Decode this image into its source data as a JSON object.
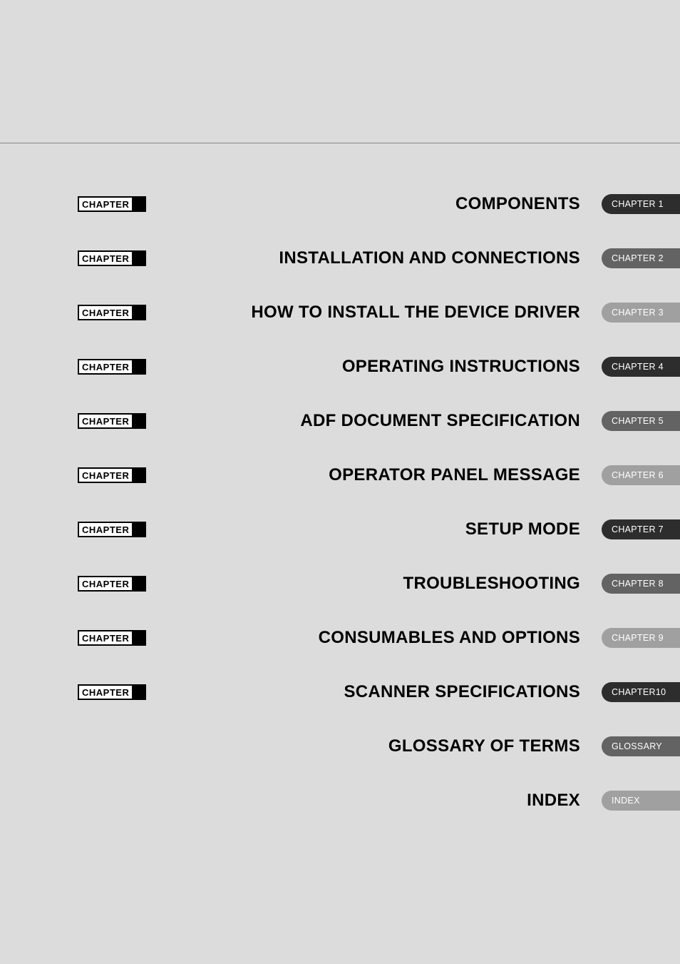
{
  "badge_label": "CHAPTER",
  "rows": [
    {
      "has_badge": true,
      "title": "COMPONENTS",
      "tab": "CHAPTER 1",
      "shade": "dark"
    },
    {
      "has_badge": true,
      "title": "INSTALLATION AND CONNECTIONS",
      "tab": "CHAPTER 2",
      "shade": "mid"
    },
    {
      "has_badge": true,
      "title": "HOW TO INSTALL THE DEVICE DRIVER",
      "tab": "CHAPTER 3",
      "shade": "light"
    },
    {
      "has_badge": true,
      "title": "OPERATING INSTRUCTIONS",
      "tab": "CHAPTER 4",
      "shade": "dark"
    },
    {
      "has_badge": true,
      "title": "ADF DOCUMENT SPECIFICATION",
      "tab": "CHAPTER 5",
      "shade": "mid"
    },
    {
      "has_badge": true,
      "title": "OPERATOR PANEL MESSAGE",
      "tab": "CHAPTER 6",
      "shade": "light"
    },
    {
      "has_badge": true,
      "title": "SETUP MODE",
      "tab": "CHAPTER 7",
      "shade": "dark"
    },
    {
      "has_badge": true,
      "title": "TROUBLESHOOTING",
      "tab": "CHAPTER 8",
      "shade": "mid"
    },
    {
      "has_badge": true,
      "title": "CONSUMABLES AND OPTIONS",
      "tab": "CHAPTER 9",
      "shade": "light"
    },
    {
      "has_badge": true,
      "title": "SCANNER SPECIFICATIONS",
      "tab": "CHAPTER10",
      "shade": "dark"
    },
    {
      "has_badge": false,
      "title": "GLOSSARY OF TERMS",
      "tab": "GLOSSARY",
      "shade": "mid"
    },
    {
      "has_badge": false,
      "title": "INDEX",
      "tab": "INDEX",
      "shade": "light"
    }
  ]
}
